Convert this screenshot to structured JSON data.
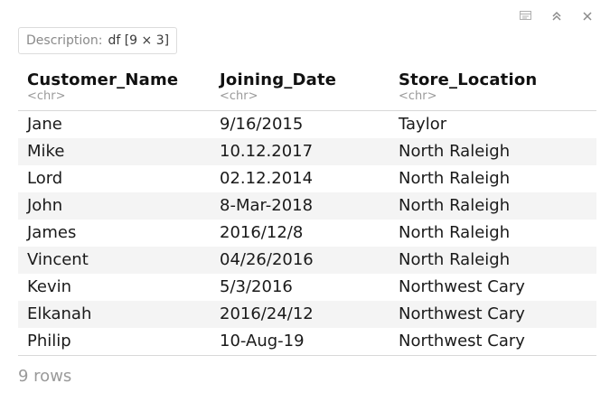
{
  "description": {
    "label": "Description:",
    "value": "df [9 × 3]"
  },
  "toolbar": {
    "icons": [
      "filter-icon",
      "collapse-icon",
      "close-icon"
    ]
  },
  "columns": [
    {
      "name": "Customer_Name",
      "type": "<chr>"
    },
    {
      "name": "Joining_Date",
      "type": "<chr>"
    },
    {
      "name": "Store_Location",
      "type": "<chr>"
    }
  ],
  "rows": [
    [
      "Jane",
      "9/16/2015",
      "Taylor"
    ],
    [
      "Mike",
      "10.12.2017",
      "North Raleigh"
    ],
    [
      "Lord",
      "02.12.2014",
      "North Raleigh"
    ],
    [
      "John",
      "8-Mar-2018",
      "North Raleigh"
    ],
    [
      "James",
      "2016/12/8",
      "North Raleigh"
    ],
    [
      "Vincent",
      "04/26/2016",
      "North Raleigh"
    ],
    [
      "Kevin",
      "5/3/2016",
      "Northwest Cary"
    ],
    [
      "Elkanah",
      "2016/24/12",
      "Northwest Cary"
    ],
    [
      "Philip",
      "10-Aug-19",
      "Northwest Cary"
    ]
  ],
  "footer": {
    "row_count": "9 rows"
  },
  "colors": {
    "stripe": "#f4f4f4",
    "muted_text": "#9a9a9a",
    "border": "#d8d8d8"
  }
}
